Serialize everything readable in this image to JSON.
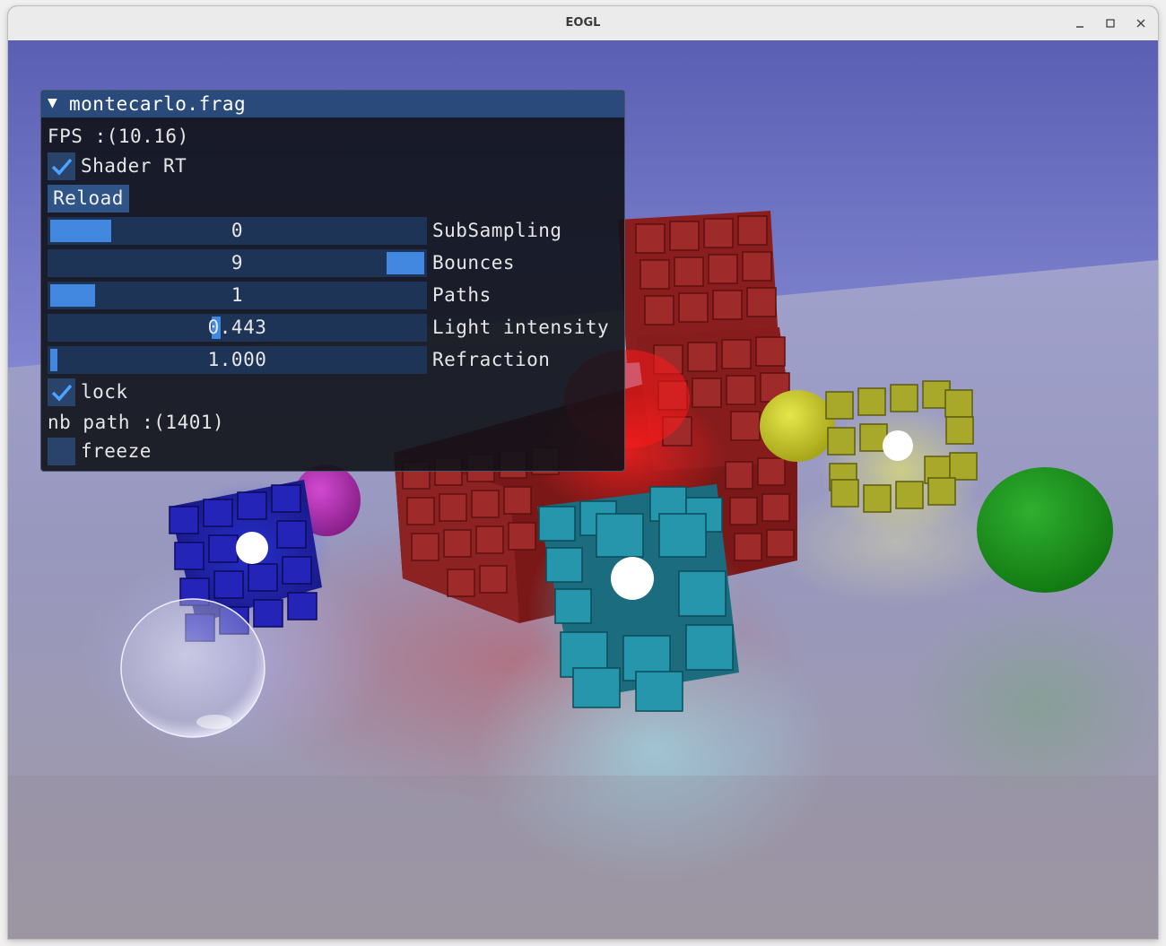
{
  "window": {
    "title": "EOGL",
    "minimize_glyph": "—",
    "maximize_glyph": "☐",
    "close_glyph": "✕"
  },
  "panel": {
    "title": "montecarlo.frag",
    "collapse_glyph": "▼",
    "fps_text": "FPS :(10.16)",
    "shader_rt": {
      "label": "Shader RT",
      "checked": true
    },
    "reload_label": "Reload",
    "sliders": [
      {
        "label": "SubSampling",
        "value": "0",
        "position": 0.0
      },
      {
        "label": "Bounces",
        "value": "9",
        "position": 1.0
      },
      {
        "label": "Paths",
        "value": "1",
        "position": 0.0
      },
      {
        "label": "Light intensity",
        "value": "0.443",
        "position": 0.443
      },
      {
        "label": "Refraction",
        "value": "1.000",
        "position": 0.0
      }
    ],
    "lock": {
      "label": "lock",
      "checked": true
    },
    "nb_path_text": "nb path :(1401)",
    "freeze": {
      "label": "freeze",
      "checked": false
    }
  },
  "colors": {
    "panel_bg": "#101218",
    "header_bg": "#294a7a",
    "frame_bg": "#1e3457",
    "accent": "#4287e0",
    "check": "#4ba3ff"
  }
}
